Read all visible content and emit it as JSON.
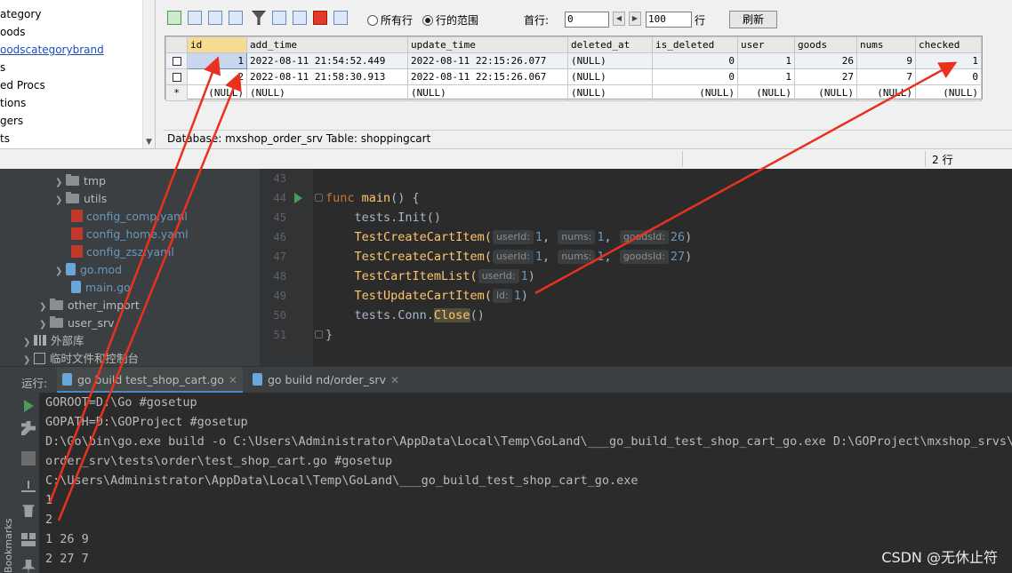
{
  "db_tool": {
    "tree_items": [
      "ategory",
      "oods",
      "oodscategorybrand",
      "s",
      "ed Procs",
      "tions",
      "gers",
      "ts"
    ],
    "toolbar": {
      "radio_all_rows": "所有行",
      "radio_range": "行的范围",
      "first_row_label": "首行:",
      "first_row_value": "0",
      "count_value": "100",
      "rows_unit": "行",
      "refresh_label": "刷新"
    },
    "grid": {
      "columns": [
        "id",
        "add_time",
        "update_time",
        "deleted_at",
        "is_deleted",
        "user",
        "goods",
        "nums",
        "checked"
      ],
      "rows": [
        [
          "1",
          "2022-08-11 21:54:52.449",
          "2022-08-11 22:15:26.077",
          "(NULL)",
          "0",
          "1",
          "26",
          "9",
          "1"
        ],
        [
          "2",
          "2022-08-11 21:58:30.913",
          "2022-08-11 22:15:26.067",
          "(NULL)",
          "0",
          "1",
          "27",
          "7",
          "0"
        ],
        [
          "(NULL)",
          "(NULL)",
          "(NULL)",
          "(NULL)",
          "(NULL)",
          "(NULL)",
          "(NULL)",
          "(NULL)",
          "(NULL)"
        ]
      ],
      "new_row_marker": "*"
    },
    "status_text": "Database: mxshop_order_srv  Table: shoppingcart",
    "row_count": "2 行"
  },
  "project_tree": {
    "items": [
      {
        "label": "tmp",
        "type": "folder"
      },
      {
        "label": "utils",
        "type": "folder"
      },
      {
        "label": "config_comp.yaml",
        "type": "yaml"
      },
      {
        "label": "config_home.yaml",
        "type": "yaml"
      },
      {
        "label": "config_zsz.yaml",
        "type": "yaml"
      },
      {
        "label": "go.mod",
        "type": "go"
      },
      {
        "label": "main.go",
        "type": "go"
      },
      {
        "label": "other_import",
        "type": "folder"
      },
      {
        "label": "user_srv",
        "type": "folder"
      },
      {
        "label": "外部库",
        "type": "lib"
      },
      {
        "label": "临时文件和控制台",
        "type": "scratch"
      }
    ]
  },
  "editor": {
    "line_numbers": [
      "43",
      "44",
      "45",
      "46",
      "47",
      "48",
      "49",
      "50",
      "51"
    ],
    "code": {
      "l44_kw": "func",
      "l44_fn": "main",
      "l44_rest": "() {",
      "l45": "tests.Init()",
      "create_call": "TestCreateCartItem(",
      "hint_user": "userId:",
      "hint_nums": "nums:",
      "hint_goods": "goodsId:",
      "l46_user": "1",
      "l46_nums": "1",
      "l46_goods": "26",
      "l47_user": "1",
      "l47_nums": "1",
      "l47_goods": "27",
      "l48_call": "TestCartItemList(",
      "l48_user": "1",
      "l49_call": "TestUpdateCartItem(",
      "hint_id": "id:",
      "l49_id": "1",
      "l50_pre": "tests.Conn.",
      "l50_close": "Close",
      "l50_post": "()",
      "l51": "}"
    }
  },
  "run_panel": {
    "title": "运行:",
    "tabs": [
      {
        "label": "go build test_shop_cart.go"
      },
      {
        "label": "go build nd/order_srv"
      }
    ],
    "bookmarks_label": "Bookmarks",
    "console_lines": [
      "GOROOT=D:\\Go #gosetup",
      "GOPATH=D:\\GOProject #gosetup",
      "D:\\Go\\bin\\go.exe build -o C:\\Users\\Administrator\\AppData\\Local\\Temp\\GoLand\\___go_build_test_shop_cart_go.exe D:\\GOProject\\mxshop_srvs\\mx",
      "order_srv\\tests\\order\\test_shop_cart.go #gosetup",
      "C:\\Users\\Administrator\\AppData\\Local\\Temp\\GoLand\\___go_build_test_shop_cart_go.exe",
      "1",
      "2",
      "1 26 9",
      "2 27 7"
    ]
  },
  "watermark": "CSDN @无休止符",
  "colors": {
    "arrow": "#e8321e",
    "editor_bg": "#2b2b2b",
    "panel_bg": "#3c3f41",
    "keyword": "#cc7832",
    "function": "#ffc66d",
    "number": "#6897bb"
  }
}
